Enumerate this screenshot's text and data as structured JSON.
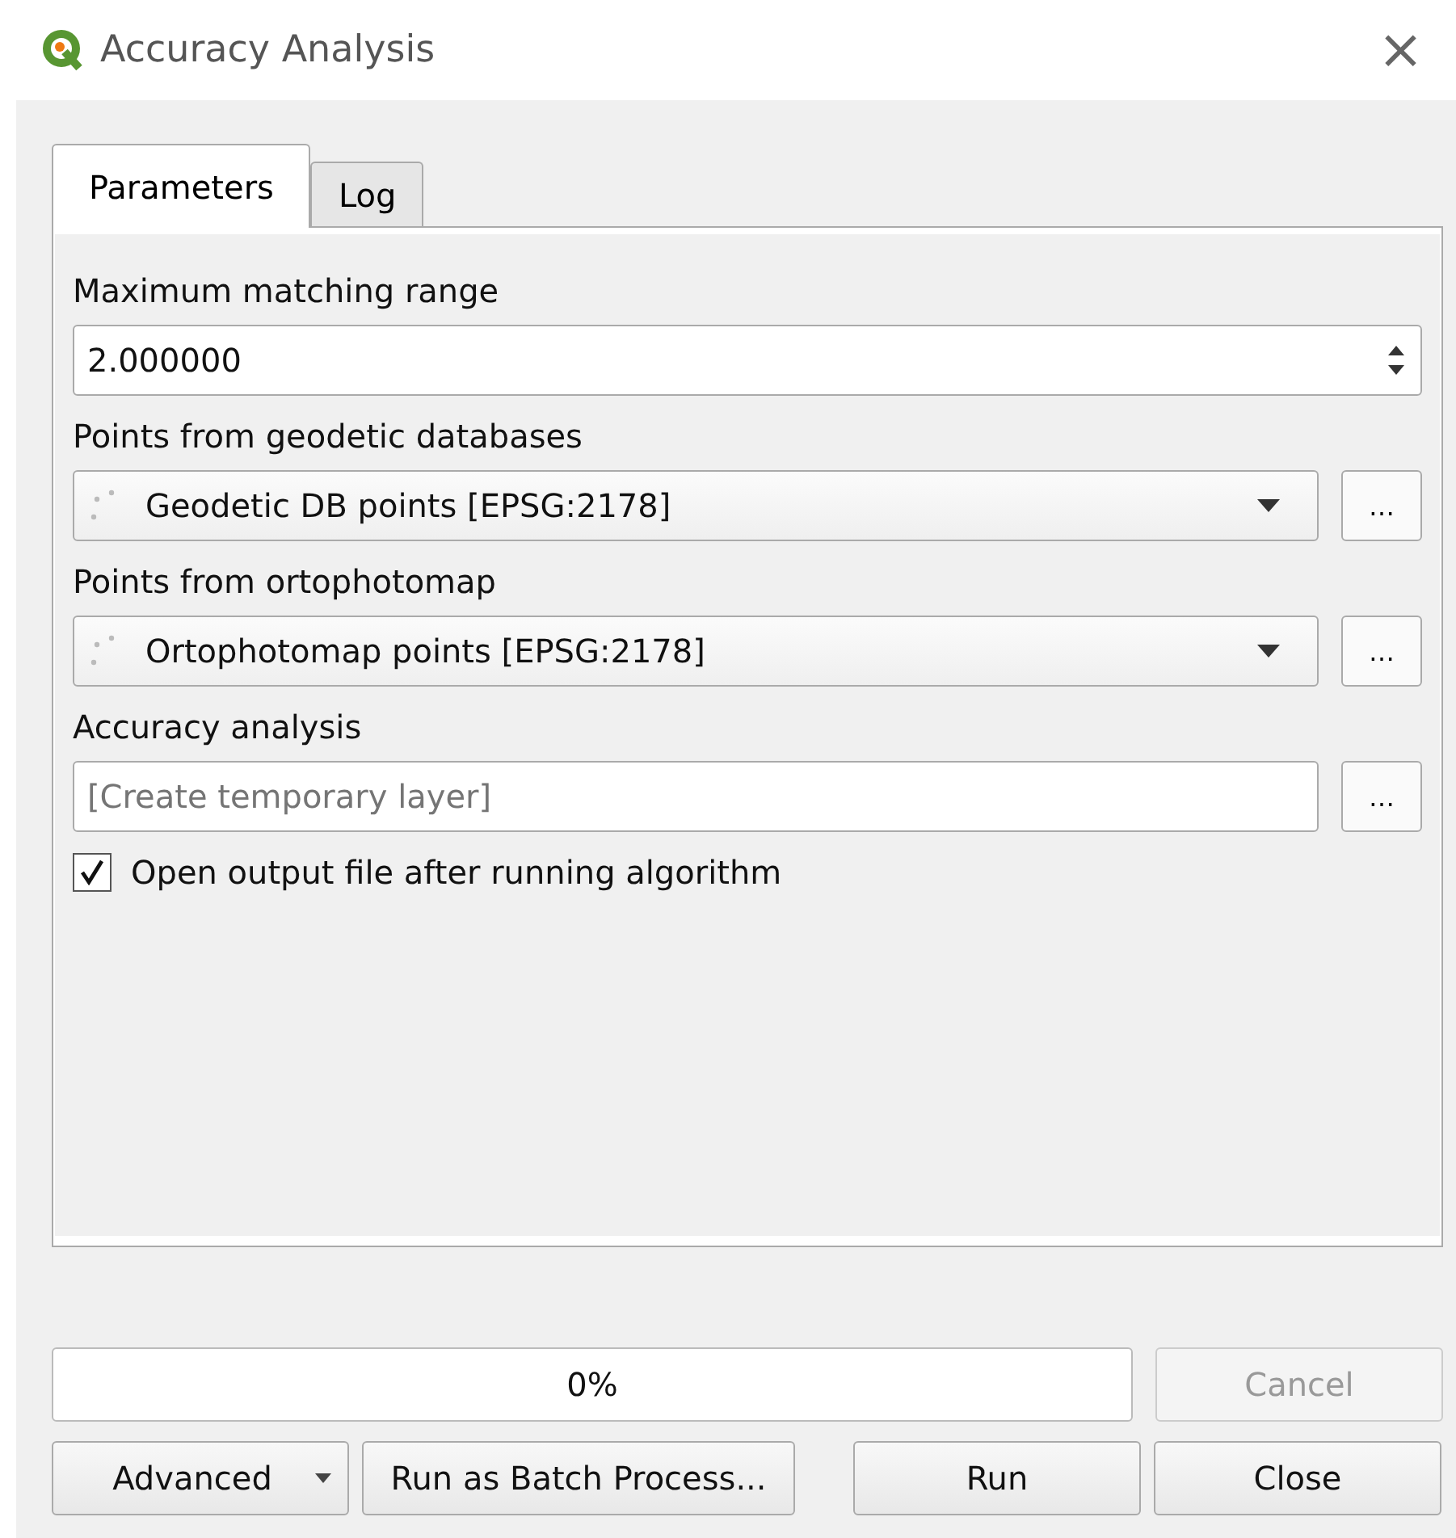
{
  "window": {
    "title": "Accuracy Analysis",
    "close": "×"
  },
  "tabs": [
    {
      "label": "Parameters",
      "selected": true
    },
    {
      "label": "Log",
      "selected": false
    }
  ],
  "parameters": [
    {
      "kind": "number",
      "label": "Maximum matching range",
      "value": "2.000000"
    },
    {
      "kind": "layer",
      "label": "Points from geodetic databases",
      "value": "Geodetic DB points [EPSG:2178]",
      "more": "…"
    },
    {
      "kind": "layer",
      "label": "Points from ortophotomap",
      "value": "Ortophotomap points [EPSG:2178]",
      "more": "…"
    },
    {
      "kind": "output",
      "label": "Accuracy analysis",
      "placeholder": "[Create temporary layer]",
      "more": "…"
    },
    {
      "kind": "checkbox",
      "label": "Open output file after running algorithm",
      "checked": true
    }
  ],
  "progress": {
    "text": "0%",
    "level": 0
  },
  "cancel": {
    "label": "Cancel",
    "disabled": true
  },
  "buttons": [
    {
      "label": "Advanced",
      "dropdown": true
    },
    {
      "label": "Run as Batch Process...",
      "dropdown": false
    },
    {
      "label": "Run",
      "dropdown": false
    },
    {
      "label": "Close",
      "dropdown": false
    }
  ]
}
